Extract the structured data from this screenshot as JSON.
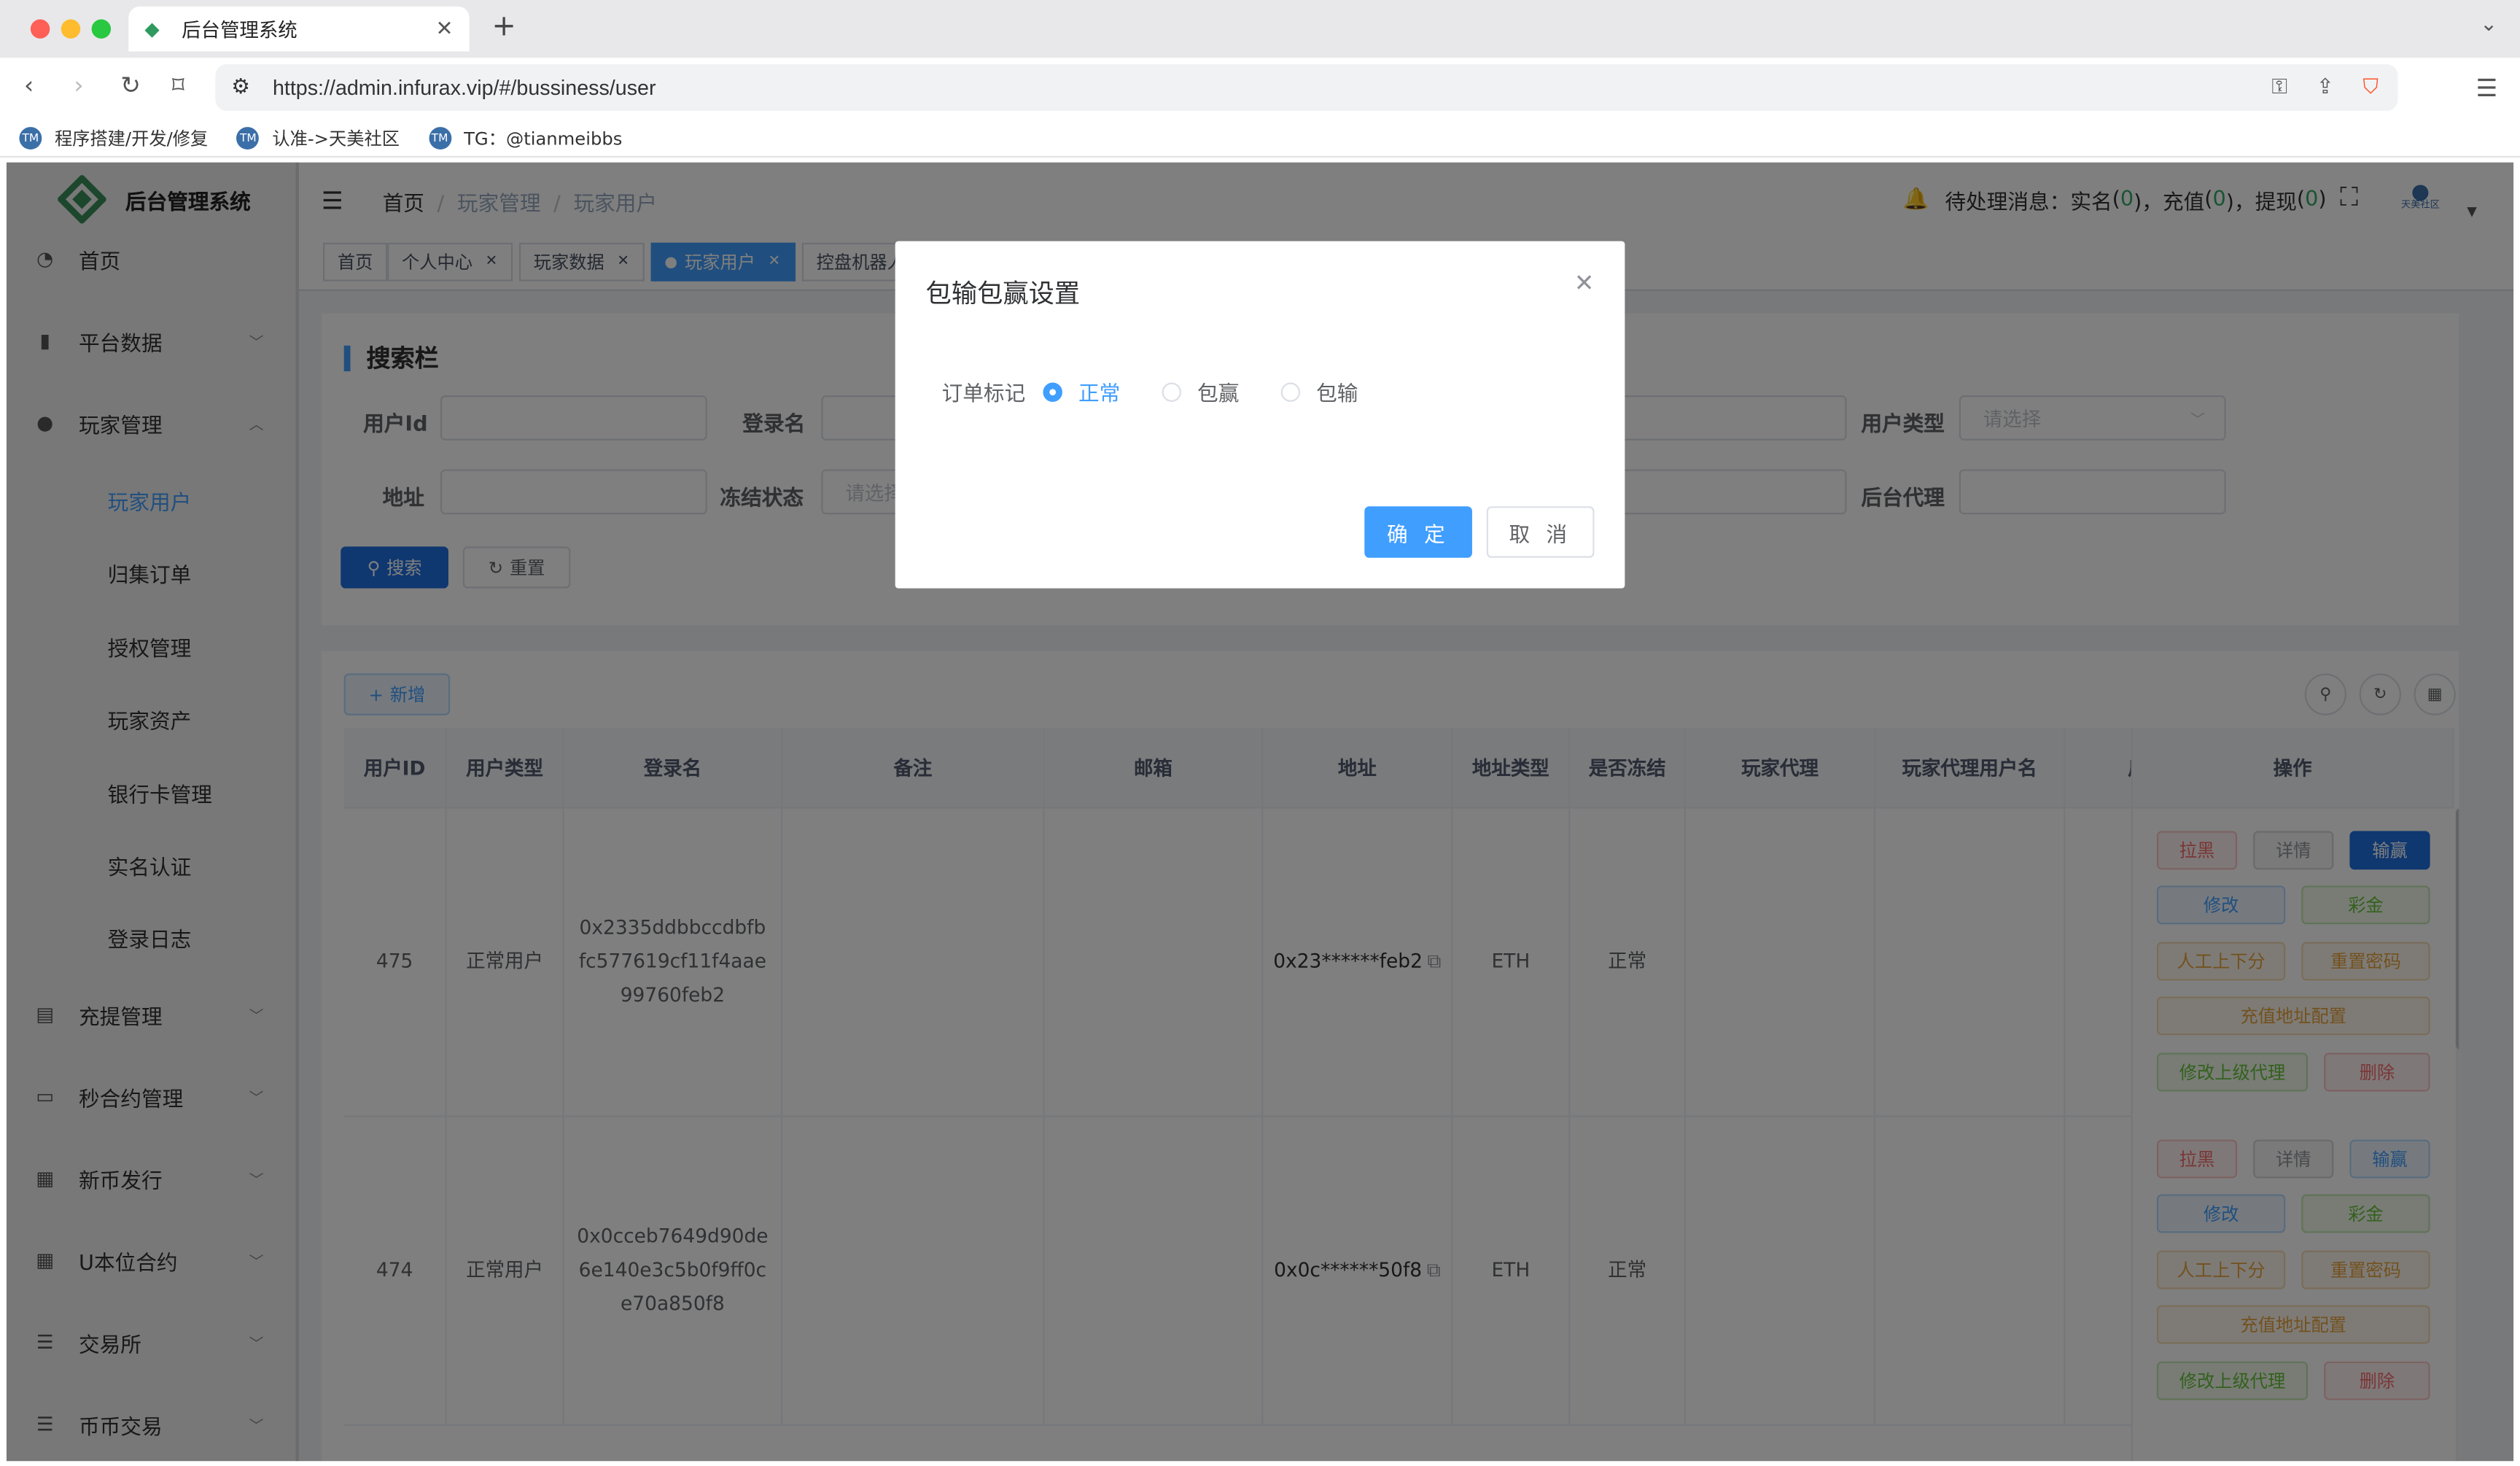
{
  "browser": {
    "tab_title": "后台管理系统",
    "url": "https://admin.infurax.vip/#/bussiness/user",
    "bookmarks": [
      "程序搭建/开发/修复",
      "认准->天美社区",
      "TG：@tianmeibbs"
    ]
  },
  "colors": {
    "primary": "#409eff",
    "primary_dark": "#1f6fe0",
    "danger": "#f56c6c",
    "success": "#67c23a",
    "warning": "#e6a23c",
    "notice_count": "#36a868"
  },
  "sidebar": {
    "app_title": "后台管理系统",
    "items": [
      {
        "label": "首页",
        "icon": "dashboard-icon"
      },
      {
        "label": "平台数据",
        "icon": "book-icon"
      },
      {
        "label": "玩家管理",
        "icon": "user-icon"
      },
      {
        "label": "充提管理",
        "icon": "clipboard-icon"
      },
      {
        "label": "秒合约管理",
        "icon": "monitor-icon"
      },
      {
        "label": "新币发行",
        "icon": "news-icon"
      },
      {
        "label": "U本位合约",
        "icon": "table-icon"
      },
      {
        "label": "交易所",
        "icon": "list-icon"
      },
      {
        "label": "币币交易",
        "icon": "list-icon"
      }
    ],
    "sub_items": [
      "玩家用户",
      "归集订单",
      "授权管理",
      "玩家资产",
      "银行卡管理",
      "实名认证",
      "登录日志"
    ]
  },
  "navbar": {
    "breadcrumb": [
      "首页",
      "玩家管理",
      "玩家用户"
    ],
    "notice_label": "待处理消息：",
    "notices": [
      {
        "label": "实名",
        "count": "0"
      },
      {
        "label": "充值",
        "count": "0"
      },
      {
        "label": "提现",
        "count": "0"
      }
    ],
    "avatar_text": "天美社区"
  },
  "tags": [
    "首页",
    "个人中心",
    "玩家数据",
    "玩家用户",
    "控盘机器人"
  ],
  "search": {
    "title": "搜索栏",
    "labels": {
      "user_id": "用户Id",
      "login_name": "登录名",
      "user_type": "用户类型",
      "address": "地址",
      "frozen": "冻结状态",
      "agent": "后台代理"
    },
    "placeholders": {
      "select": "请选择",
      "frozen": "请选择"
    },
    "search_btn": "搜索",
    "reset_btn": "重置"
  },
  "table": {
    "add_btn": "新增",
    "columns": [
      "用户ID",
      "用户类型",
      "登录名",
      "备注",
      "邮箱",
      "地址",
      "地址类型",
      "是否冻结",
      "玩家代理",
      "玩家代理用户名",
      "后",
      "操作"
    ],
    "rows": [
      {
        "id": "475",
        "type": "正常用户",
        "login": "0x2335ddbbccdbfbfc577619cf11f4aae99760feb2",
        "remark": "",
        "email": "",
        "address": "0x23******feb2",
        "addr_type": "ETH",
        "frozen": "正常"
      },
      {
        "id": "474",
        "type": "正常用户",
        "login": "0x0cceb7649d90de6e140e3c5b0f9ff0ce70a850f8",
        "remark": "",
        "email": "",
        "address": "0x0c******50f8",
        "addr_type": "ETH",
        "frozen": "正常"
      }
    ],
    "op_buttons": {
      "blacklist": "拉黑",
      "detail": "详情",
      "lose": "输赢",
      "edit": "修改",
      "bonus": "彩金",
      "manual": "人工上下分",
      "reset_pwd": "重置密码",
      "recharge_addr": "充值地址配置",
      "edit_parent": "修改上级代理",
      "delete": "删除"
    }
  },
  "dialog": {
    "title": "包输包赢设置",
    "field_label": "订单标记",
    "options": [
      "正常",
      "包赢",
      "包输"
    ],
    "selected": "正常",
    "confirm": "确 定",
    "cancel": "取 消"
  }
}
